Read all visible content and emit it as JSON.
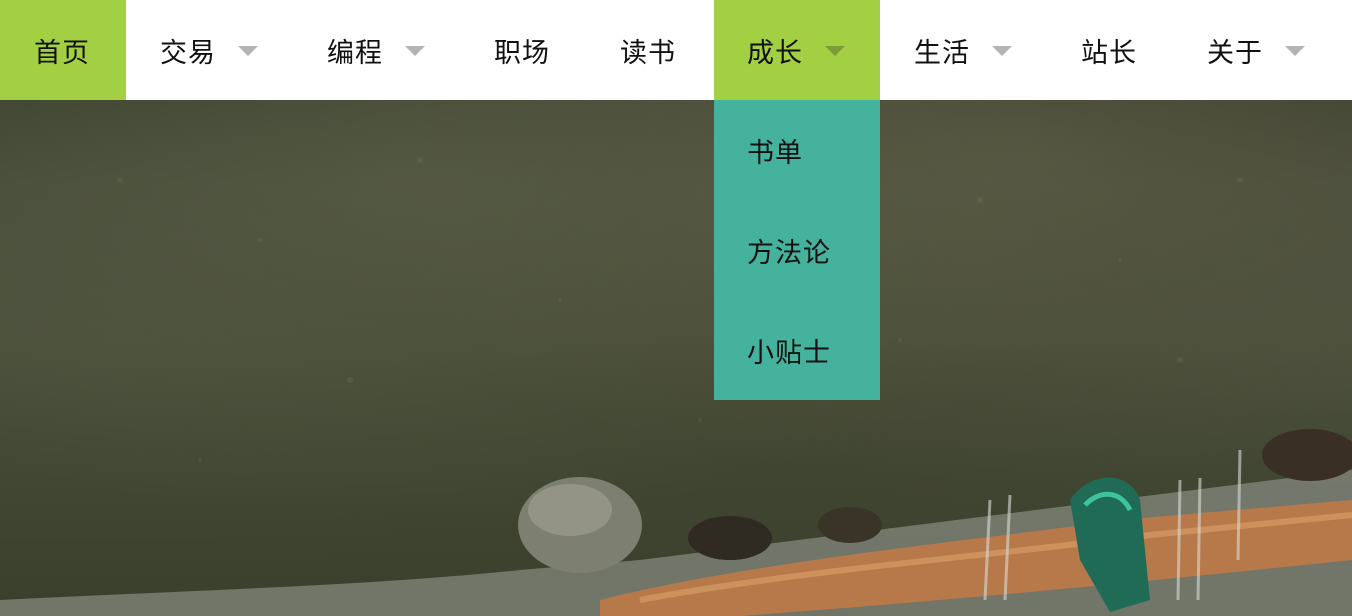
{
  "nav": {
    "items": [
      {
        "label": "首页",
        "active": true,
        "has_dropdown": false
      },
      {
        "label": "交易",
        "active": false,
        "has_dropdown": true
      },
      {
        "label": "编程",
        "active": false,
        "has_dropdown": true
      },
      {
        "label": "职场",
        "active": false,
        "has_dropdown": false
      },
      {
        "label": "读书",
        "active": false,
        "has_dropdown": false
      },
      {
        "label": "成长",
        "active": true,
        "has_dropdown": true
      },
      {
        "label": "生活",
        "active": false,
        "has_dropdown": true
      },
      {
        "label": "站长",
        "active": false,
        "has_dropdown": false
      },
      {
        "label": "关于",
        "active": false,
        "has_dropdown": true
      }
    ]
  },
  "dropdown": {
    "parent": "成长",
    "items": [
      {
        "label": "书单"
      },
      {
        "label": "方法论"
      },
      {
        "label": "小贴士"
      }
    ]
  },
  "colors": {
    "nav_background": "#ffffff",
    "active_background": "#a3d043",
    "dropdown_background": "#44b29c",
    "caret": "#b4b4b4",
    "text": "#111111"
  },
  "icons": {
    "dropdown_indicator": "chevron-down-icon",
    "hero_image": "river-waterfall-photo"
  }
}
